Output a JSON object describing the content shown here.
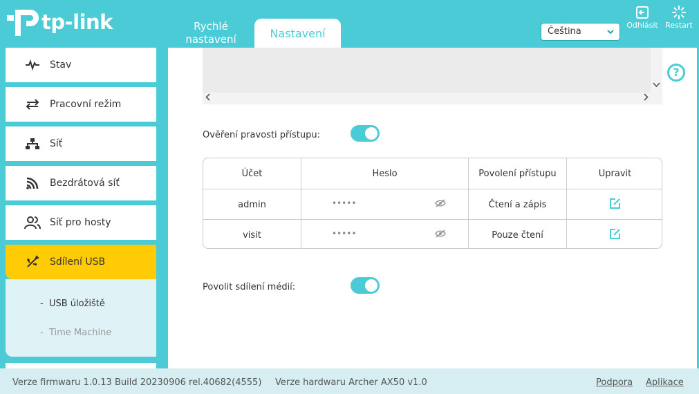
{
  "brand": {
    "name": "tp-link"
  },
  "tabs": {
    "quick": "Rychlé nastavení",
    "settings": "Nastavení"
  },
  "language": {
    "selected": "Čeština"
  },
  "header_buttons": {
    "logout": "Odhlásit",
    "restart": "Restart"
  },
  "sidebar": {
    "items": [
      {
        "label": "Stav",
        "icon": "pulse-icon"
      },
      {
        "label": "Pracovní režim",
        "icon": "swap-arrows-icon"
      },
      {
        "label": "Síť",
        "icon": "network-icon"
      },
      {
        "label": "Bezdrátová síť",
        "icon": "wifi-icon"
      },
      {
        "label": "Síť pro hosty",
        "icon": "guest-users-icon"
      },
      {
        "label": "Sdílení USB",
        "icon": "usb-icon"
      }
    ],
    "sub_items": [
      {
        "label": "USB úložiště"
      },
      {
        "label": "Time Machine"
      }
    ],
    "sub_prefix": "-"
  },
  "main": {
    "auth_label": "Ověření pravosti přístupu:",
    "auth_enabled": true,
    "media_label": "Povolit sdílení médií:",
    "media_enabled": true,
    "table": {
      "headers": [
        "Účet",
        "Heslo",
        "Povolení přístupu",
        "Upravit"
      ],
      "rows": [
        {
          "account": "admin",
          "password": "•••••",
          "access": "Čtení a zápis"
        },
        {
          "account": "visit",
          "password": "•••••",
          "access": "Pouze čtení"
        }
      ]
    },
    "help_glyph": "?"
  },
  "footer": {
    "firmware": "Verze firmwaru 1.0.13 Build 20230906 rel.40682(4555)",
    "hardware": "Verze hardwaru Archer AX50 v1.0",
    "support": "Podpora",
    "apps": "Aplikace"
  },
  "colors": {
    "accent": "#4acbd6",
    "active": "#ffcb05"
  }
}
